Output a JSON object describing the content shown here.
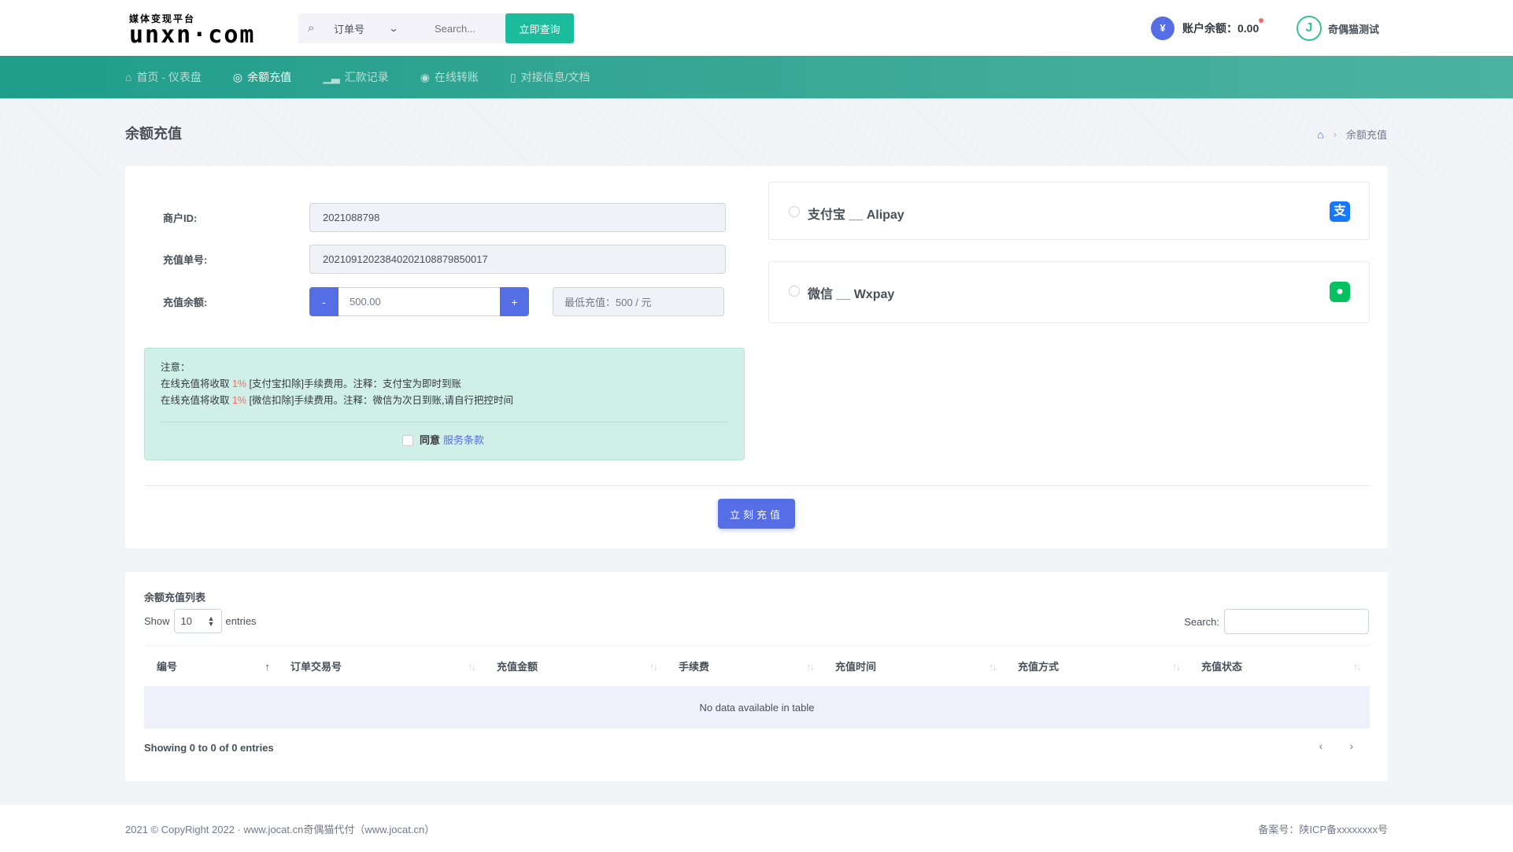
{
  "logo": {
    "subtitle": "媒体变现平台",
    "main": "unxn·com"
  },
  "search": {
    "type_label": "订单号",
    "placeholder": "Search...",
    "button": "立即查询"
  },
  "account": {
    "currency_symbol": "¥",
    "balance_label": "账户余额：0.00",
    "user_name": "奇偶猫测试",
    "avatar_letter": "J"
  },
  "nav": [
    {
      "label": "首页 - 仪表盘",
      "icon": "home-icon",
      "active": false
    },
    {
      "label": "余额充值",
      "icon": "target-icon",
      "active": true
    },
    {
      "label": "汇款记录",
      "icon": "bar-chart-icon",
      "active": false
    },
    {
      "label": "在线转账",
      "icon": "transfer-icon",
      "active": false
    },
    {
      "label": "对接信息/文档",
      "icon": "book-icon",
      "active": false
    }
  ],
  "page": {
    "title": "余额充值",
    "breadcrumb_current": "余额充值"
  },
  "form": {
    "merchant_label": "商户ID:",
    "merchant_value": "2021088798",
    "order_label": "充值单号:",
    "order_value": "20210912023840202108879850017",
    "amount_label": "充值余额:",
    "minus": "-",
    "amount_value": "500.00",
    "plus": "+",
    "min_text": "最低充值：500 / 元"
  },
  "notice": {
    "title": "注意：",
    "line1_a": "在线充值将收取 ",
    "line1_pct": "1%",
    "line1_b": " [支付宝扣除]手续费用。注释：支付宝为即时到账",
    "line2_a": "在线充值将收取 ",
    "line2_pct": "1%",
    "line2_b": " [微信扣除]手续费用。注释：微信为次日到账,请自行把控时间",
    "agree": "同意",
    "terms": "服务条款"
  },
  "payments": [
    {
      "label": "支付宝 __ Alipay",
      "icon": "alipay-icon",
      "color": "#1677ff"
    },
    {
      "label": "微信 __ Wxpay",
      "icon": "wechat-icon",
      "color": "#07c160"
    }
  ],
  "submit": "立刻充值",
  "list": {
    "title": "余额充值列表",
    "show": "Show",
    "page_size": "10",
    "entries": "entries",
    "search_label": "Search:",
    "columns": [
      "编号",
      "订单交易号",
      "充值金额",
      "手续费",
      "充值时间",
      "充值方式",
      "充值状态"
    ],
    "empty": "No data available in table",
    "info": "Showing 0 to 0 of 0 entries",
    "prev": "‹",
    "next": "›"
  },
  "footer": {
    "left": "2021 © CopyRight 2022 · www.jocat.cn奇偶猫代付（www.jocat.cn）",
    "right": "备案号：陕ICP备xxxxxxxx号"
  },
  "colors": {
    "primary": "#556ee6",
    "success": "#1abc9c",
    "nav": "#2aa38f",
    "danger": "#f46a6a"
  }
}
